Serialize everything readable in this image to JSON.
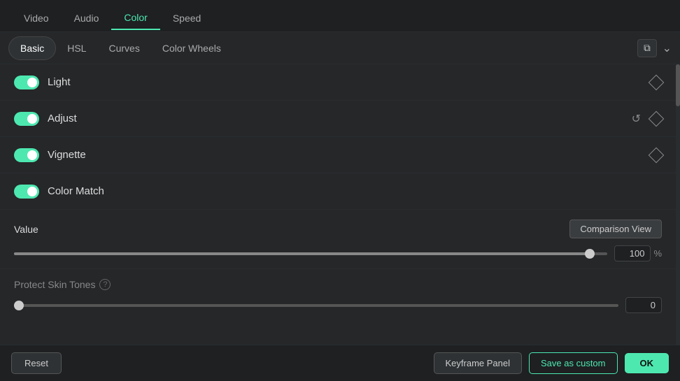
{
  "topTabs": {
    "items": [
      {
        "id": "video",
        "label": "Video"
      },
      {
        "id": "audio",
        "label": "Audio"
      },
      {
        "id": "color",
        "label": "Color"
      },
      {
        "id": "speed",
        "label": "Speed"
      }
    ],
    "active": "color"
  },
  "subTabs": {
    "items": [
      {
        "id": "basic",
        "label": "Basic"
      },
      {
        "id": "hsl",
        "label": "HSL"
      },
      {
        "id": "curves",
        "label": "Curves"
      },
      {
        "id": "colorwheels",
        "label": "Color Wheels"
      }
    ],
    "active": "basic"
  },
  "sections": [
    {
      "id": "light",
      "label": "Light",
      "hasReset": false,
      "hasDiamond": true
    },
    {
      "id": "adjust",
      "label": "Adjust",
      "hasReset": true,
      "hasDiamond": true
    },
    {
      "id": "vignette",
      "label": "Vignette",
      "hasReset": false,
      "hasDiamond": true
    },
    {
      "id": "colormatch",
      "label": "Color Match",
      "hasReset": false,
      "hasDiamond": false
    }
  ],
  "valueSection": {
    "label": "Value",
    "comparisonViewLabel": "Comparison View",
    "sliderValue": "100",
    "sliderUnit": "%",
    "sliderPercent": 97
  },
  "protectSection": {
    "label": "Protect Skin Tones",
    "sliderValue": "0",
    "sliderPercent": 0
  },
  "bottomBar": {
    "resetLabel": "Reset",
    "keyframeLabel": "Keyframe Panel",
    "saveCustomLabel": "Save as custom",
    "okLabel": "OK"
  }
}
